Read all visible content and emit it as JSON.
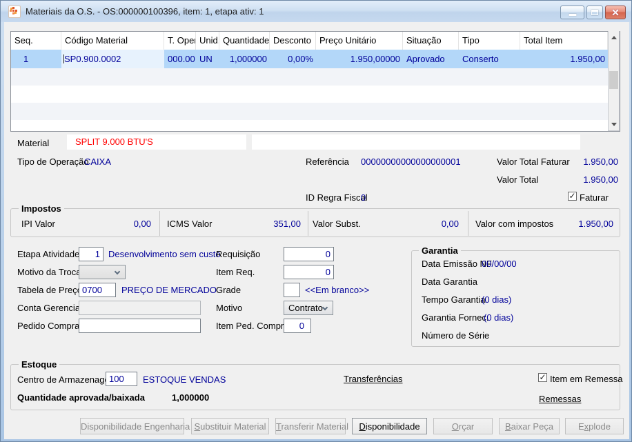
{
  "window": {
    "title": "Materiais da O.S. - OS:000000100396, item: 1, etapa ativ: 1"
  },
  "icons": {
    "titlebar": [
      "app-icon",
      "minimize-icon",
      "maximize-icon",
      "close-icon"
    ],
    "scrollbar": [
      "scroll-up-icon",
      "scroll-down-icon"
    ],
    "combos": [
      "chevron-down-icon"
    ]
  },
  "colors": {
    "value_text": "#000099",
    "material_text": "#FF0000",
    "row_selection": "#B3D7F9",
    "titlebar_blue": "#C6D9EF",
    "close_button_red": "#D4654E"
  },
  "grid": {
    "columns": [
      "Seq.",
      "Código Material",
      "T. Oper",
      "Unid.",
      "Quantidade",
      "Desconto",
      "Preço Unitário",
      "Situação",
      "Tipo",
      "Total Item"
    ],
    "rows": [
      [
        "1",
        "SP0.900.0002",
        "000.00",
        "UN",
        "1,000000",
        "0,00%",
        "1.950,00000",
        "Aprovado",
        "Conserto",
        "1.950,00"
      ]
    ]
  },
  "detail": {
    "material": {
      "label": "Material",
      "value": "SPLIT 9.000 BTU'S"
    },
    "tipo_operacao": {
      "label": "Tipo de Operação",
      "value": "CAIXA"
    },
    "referencia": {
      "label": "Referência",
      "value": "00000000000000000001"
    },
    "valor_total_faturar": {
      "label": "Valor Total Faturar",
      "value": "1.950,00"
    },
    "valor_total": {
      "label": "Valor Total",
      "value": "1.950,00"
    },
    "id_regra_fiscal": {
      "label": "ID Regra Fiscal",
      "value": "0"
    },
    "faturar": {
      "label": "Faturar",
      "checked": true
    }
  },
  "impostos": {
    "title": "Impostos",
    "fields": [
      {
        "label": "IPI Valor",
        "value": "0,00"
      },
      {
        "label": "ICMS Valor",
        "value": "351,00"
      },
      {
        "label": "Valor Subst.",
        "value": "0,00"
      },
      {
        "label": "Valor com impostos",
        "value": "1.950,00"
      }
    ]
  },
  "form": {
    "etapa_atividade": {
      "label": "Etapa Atividade",
      "value": "1",
      "description": "Desenvolvimento sem custo"
    },
    "motivo_troca": {
      "label": "Motivo da Troca",
      "value": ""
    },
    "tabela_preco": {
      "label": "Tabela de Preço",
      "value": "0700",
      "description": "PREÇO DE MERCADO"
    },
    "conta_gerencial": {
      "label": "Conta Gerencial",
      "value": ""
    },
    "pedido_compra": {
      "label": "Pedido Compra",
      "value": ""
    },
    "requisicao": {
      "label": "Requisição",
      "value": "0"
    },
    "item_req": {
      "label": "Item Req.",
      "value": "0"
    },
    "grade": {
      "label": "Grade",
      "value": "",
      "description": "<<Em branco>>"
    },
    "motivo": {
      "label": "Motivo",
      "value": "Contrato"
    },
    "item_ped_compra": {
      "label": "Item Ped. Compra",
      "value": "0"
    }
  },
  "garantia": {
    "title": "Garantia",
    "fields": [
      {
        "label": "Data Emissão NF",
        "value": "00/00/00"
      },
      {
        "label": "Data Garantia",
        "value": ""
      },
      {
        "label": "Tempo Garantia",
        "value": "(0 dias)"
      },
      {
        "label": "Garantia Fornec.",
        "value": "(0 dias)"
      },
      {
        "label": "Número de Série",
        "value": ""
      }
    ]
  },
  "estoque": {
    "title": "Estoque",
    "centro_armazenagem": {
      "label": "Centro de Armazenagem",
      "value": "100",
      "description": "ESTOQUE VENDAS"
    },
    "transferencias_link": "Transferências",
    "item_em_remessa": {
      "label": "Item em Remessa",
      "checked": true
    },
    "quantidade_aprovada": {
      "label": "Quantidade aprovada/baixada",
      "value": "1,000000"
    },
    "remessas_link": "Remessas"
  },
  "footer_buttons": [
    {
      "label": "Disponibilidade Engenharia",
      "enabled": false,
      "underline": -1
    },
    {
      "label": "Substituir Material",
      "enabled": false,
      "underline": 0
    },
    {
      "label": "Transferir Material",
      "enabled": false,
      "underline": 0
    },
    {
      "label": "Disponibilidade",
      "enabled": true,
      "underline": 0
    },
    {
      "label": "Orçar",
      "enabled": false,
      "underline": 0
    },
    {
      "label": "Baixar Peça",
      "enabled": false,
      "underline": 0
    },
    {
      "label": "Explode",
      "enabled": false,
      "underline": 1
    }
  ]
}
